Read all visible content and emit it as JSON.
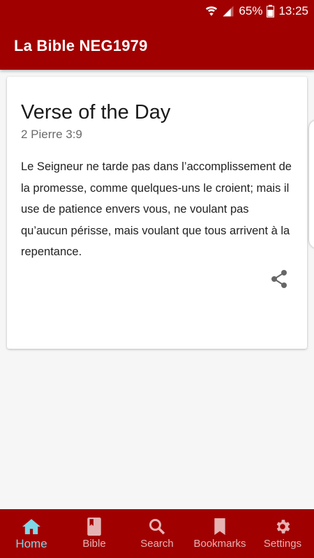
{
  "status_bar": {
    "battery_percent": "65%",
    "time": "13:25",
    "icons": [
      "wifi-icon",
      "signal-icon",
      "battery-icon"
    ]
  },
  "app_bar": {
    "title": "La Bible NEG1979"
  },
  "verse_card": {
    "title": "Verse of the Day",
    "reference": "2 Pierre 3:9",
    "text": "Le Seigneur ne tarde pas dans l’accomplissement de la promesse, comme quelques-uns le croient; mais il use de patience envers vous, ne voulant pas qu’aucun périsse, mais voulant que tous arrivent à la repentance.",
    "share_icon": "share-icon"
  },
  "bottom_nav": {
    "items": [
      {
        "label": "Home",
        "icon": "home-icon",
        "active": true
      },
      {
        "label": "Bible",
        "icon": "book-icon",
        "active": false
      },
      {
        "label": "Search",
        "icon": "search-icon",
        "active": false
      },
      {
        "label": "Bookmarks",
        "icon": "bookmark-icon",
        "active": false
      },
      {
        "label": "Settings",
        "icon": "gear-icon",
        "active": false
      }
    ]
  },
  "colors": {
    "primary": "#a10000",
    "active_tab": "#7fd6e6",
    "inactive_tab": "#e6b3b3",
    "background": "#f6f6f6"
  }
}
